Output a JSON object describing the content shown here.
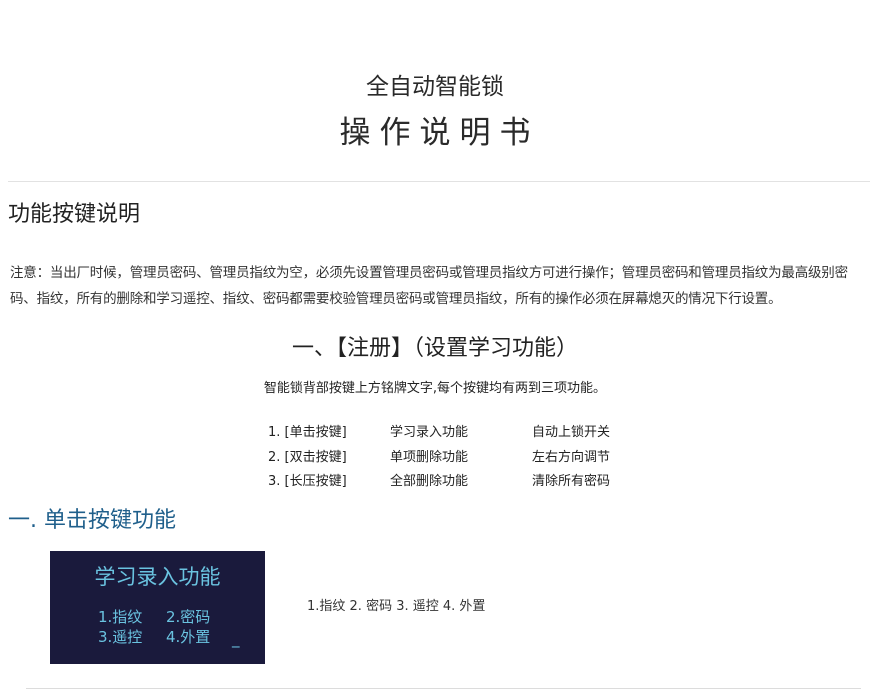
{
  "header": {
    "subtitle": "全自动智能锁",
    "title": "操作说明书"
  },
  "section": {
    "heading": "功能按键说明",
    "notice": "注意：当出厂时候，管理员密码、管理员指纹为空，必须先设置管理员密码或管理员指纹方可进行操作；管理员密码和管理员指纹为最高级别密码、指纹，所有的删除和学习遥控、指纹、密码都需要校验管理员密码或管理员指纹，所有的操作必须在屏幕熄灭的情况下行设置。"
  },
  "register": {
    "title": "一、【注册】（设置学习功能）",
    "intro": "智能锁背部按键上方铭牌文字,每个按键均有两到三项功能。",
    "rows": [
      {
        "key": "1. [单击按键]",
        "func1": "学习录入功能",
        "func2": "自动上锁开关"
      },
      {
        "key": "2. [双击按键]",
        "func1": "单项删除功能",
        "func2": "左右方向调节"
      },
      {
        "key": "3. [长压按键]",
        "func1": "全部删除功能",
        "func2": "清除所有密码"
      }
    ]
  },
  "single_click": {
    "heading": "一. 单击按键功能",
    "screen": {
      "title": "学习录入功能",
      "opt1": "1.指纹",
      "opt2": "2.密码",
      "opt3": "3.遥控",
      "opt4": "4.外置",
      "cursor": "_"
    },
    "description": "1.指纹 2. 密码 3. 遥控 4. 外置"
  },
  "colors": {
    "heading_blue": "#1f5f8b",
    "screen_bg": "#1a1a3c",
    "screen_text": "#6ac3e0"
  }
}
